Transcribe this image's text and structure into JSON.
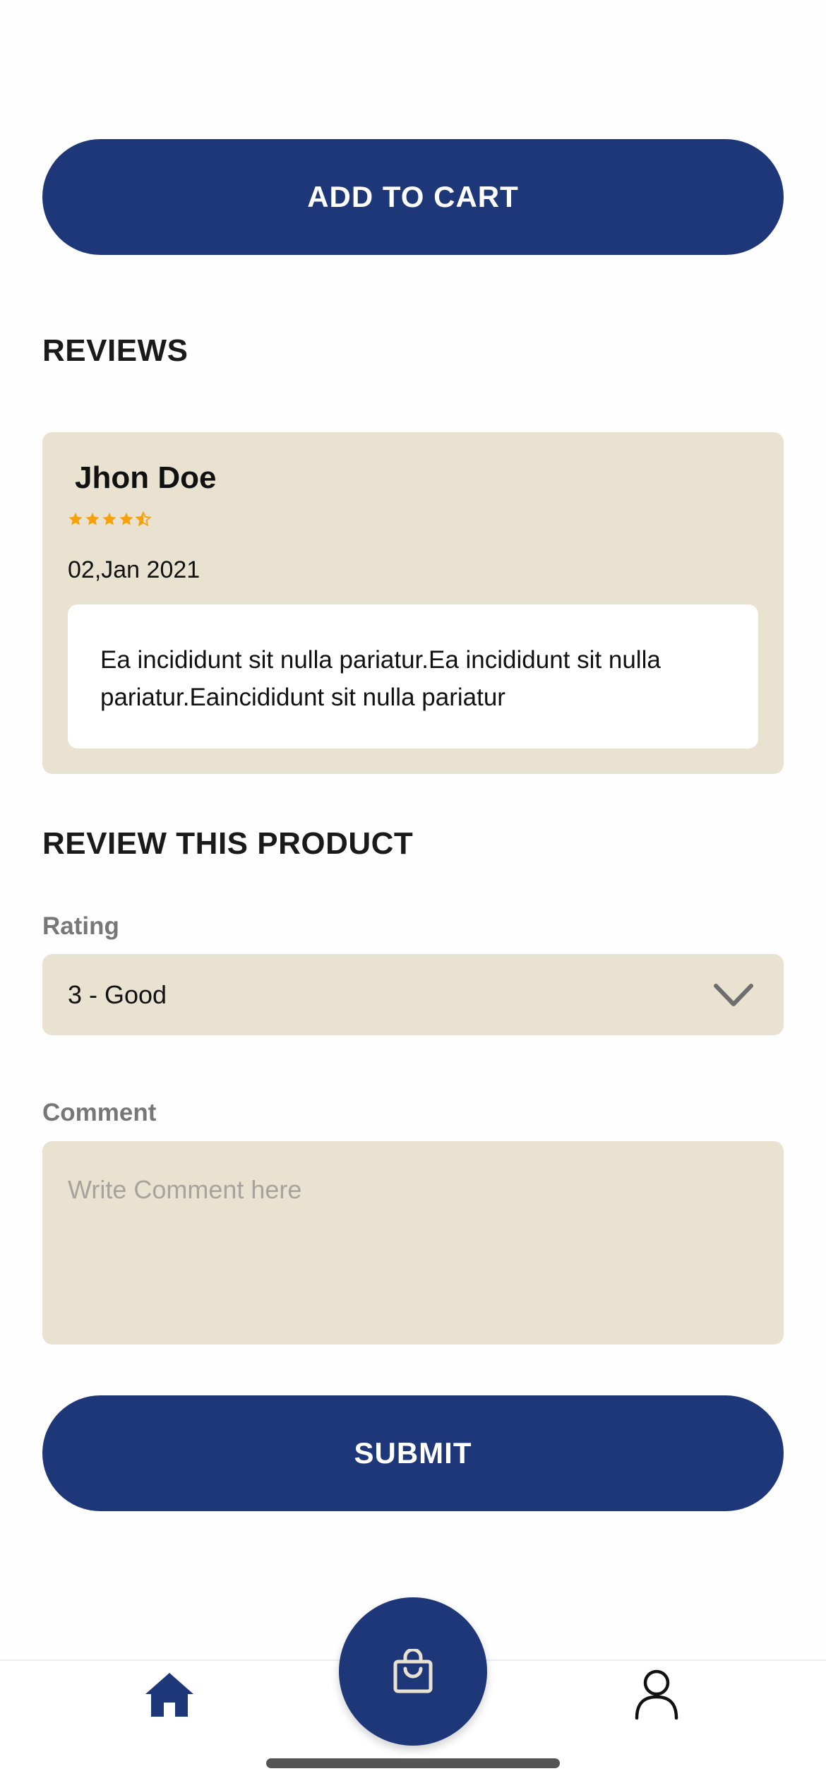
{
  "product": {
    "add_to_cart_label": "ADD TO CART"
  },
  "reviews": {
    "heading": "REVIEWS",
    "items": [
      {
        "author": "Jhon Doe",
        "rating": 4.5,
        "rating_max": 5,
        "date": "02,Jan 2021",
        "text": "Ea incididunt sit nulla pariatur.Ea incididunt sit nulla pariatur.Eaincididunt sit nulla pariatur"
      }
    ]
  },
  "review_form": {
    "heading": "REVIEW THIS PRODUCT",
    "rating_label": "Rating",
    "rating_value": "3 - Good",
    "comment_label": "Comment",
    "comment_placeholder": "Write Comment here",
    "submit_label": "SUBMIT"
  },
  "bottom_nav": {
    "items": [
      {
        "icon": "home-icon",
        "active": true
      },
      {
        "icon": "shopping-bag-icon",
        "active": false
      },
      {
        "icon": "user-icon",
        "active": false
      }
    ]
  },
  "colors": {
    "primary": "#1e3778",
    "surface": "#e9e2d1",
    "star": "#f5a00f",
    "label_gray": "#777777"
  }
}
